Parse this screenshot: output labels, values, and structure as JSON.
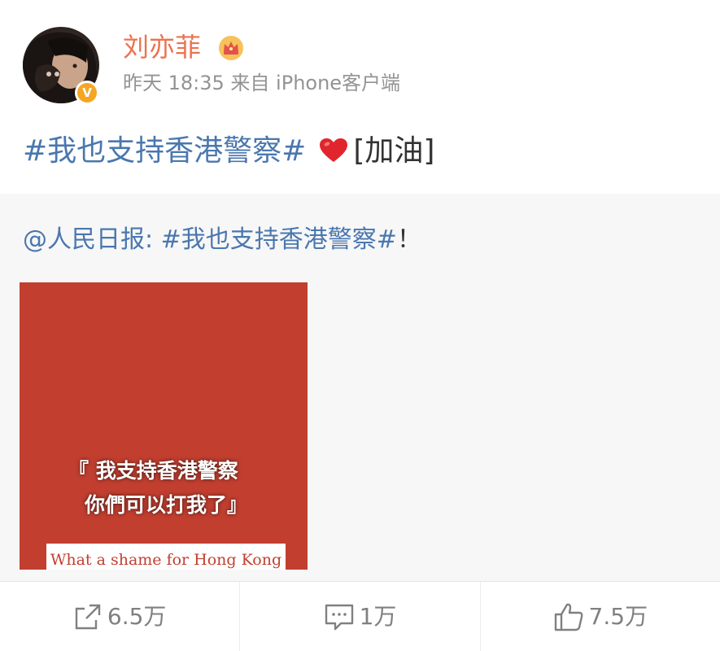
{
  "user": {
    "name": "刘亦菲",
    "verified_badge": "V",
    "meta": "昨天 18:35 来自 iPhone客户端",
    "avatar_icon": "avatar-photo",
    "crown_icon": "vip-crown-icon"
  },
  "post": {
    "hashtag": "#我也支持香港警察#",
    "suffix": "[加油]",
    "heart_icon": "heart-icon"
  },
  "repost": {
    "mention": "@人民日报:",
    "hashtag": "#我也支持香港警察#",
    "suffix": "！",
    "image": {
      "quote_line_1": "『 我支持香港警察",
      "quote_line_2": "你們可以打我了』",
      "banner": "What a shame for Hong Kong",
      "background_color": "#c23f30"
    }
  },
  "actions": {
    "repost_count": "6.5万",
    "comment_count": "1万",
    "like_count": "7.5万"
  },
  "colors": {
    "name": "#eb7350",
    "link": "#4a77ae",
    "meta": "#939393",
    "badge": "#f5a623"
  }
}
